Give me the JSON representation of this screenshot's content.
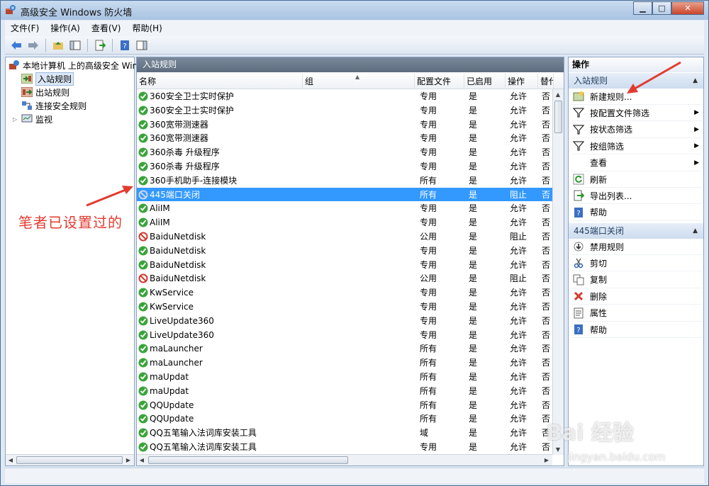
{
  "window": {
    "title": "高级安全 Windows 防火墙"
  },
  "menu": [
    "文件(F)",
    "操作(A)",
    "查看(V)",
    "帮助(H)"
  ],
  "tree": {
    "root": "本地计算机 上的高级安全 Wind",
    "items": [
      "入站规则",
      "出站规则",
      "连接安全规则",
      "监视"
    ]
  },
  "list": {
    "title": "入站规则",
    "columns": [
      "名称",
      "组",
      "配置文件",
      "已启用",
      "操作",
      "替代"
    ],
    "rows": [
      {
        "name": "360安全卫士实时保护",
        "profile": "专用",
        "enabled": "是",
        "action": "允许",
        "override": "否",
        "icon": "allow"
      },
      {
        "name": "360安全卫士实时保护",
        "profile": "专用",
        "enabled": "是",
        "action": "允许",
        "override": "否",
        "icon": "allow"
      },
      {
        "name": "360宽带测速器",
        "profile": "专用",
        "enabled": "是",
        "action": "允许",
        "override": "否",
        "icon": "allow"
      },
      {
        "name": "360宽带测速器",
        "profile": "专用",
        "enabled": "是",
        "action": "允许",
        "override": "否",
        "icon": "allow"
      },
      {
        "name": "360杀毒 升级程序",
        "profile": "专用",
        "enabled": "是",
        "action": "允许",
        "override": "否",
        "icon": "allow"
      },
      {
        "name": "360杀毒 升级程序",
        "profile": "专用",
        "enabled": "是",
        "action": "允许",
        "override": "否",
        "icon": "allow"
      },
      {
        "name": "360手机助手-连接模块",
        "profile": "所有",
        "enabled": "是",
        "action": "允许",
        "override": "否",
        "icon": "allow"
      },
      {
        "name": "445端口关闭",
        "profile": "所有",
        "enabled": "是",
        "action": "阻止",
        "override": "否",
        "icon": "block",
        "selected": true
      },
      {
        "name": "AliIM",
        "profile": "专用",
        "enabled": "是",
        "action": "允许",
        "override": "否",
        "icon": "allow"
      },
      {
        "name": "AliIM",
        "profile": "专用",
        "enabled": "是",
        "action": "允许",
        "override": "否",
        "icon": "allow"
      },
      {
        "name": "BaiduNetdisk",
        "profile": "公用",
        "enabled": "是",
        "action": "阻止",
        "override": "否",
        "icon": "block"
      },
      {
        "name": "BaiduNetdisk",
        "profile": "专用",
        "enabled": "是",
        "action": "允许",
        "override": "否",
        "icon": "allow"
      },
      {
        "name": "BaiduNetdisk",
        "profile": "专用",
        "enabled": "是",
        "action": "允许",
        "override": "否",
        "icon": "allow"
      },
      {
        "name": "BaiduNetdisk",
        "profile": "公用",
        "enabled": "是",
        "action": "阻止",
        "override": "否",
        "icon": "block"
      },
      {
        "name": "KwService",
        "profile": "专用",
        "enabled": "是",
        "action": "允许",
        "override": "否",
        "icon": "allow"
      },
      {
        "name": "KwService",
        "profile": "专用",
        "enabled": "是",
        "action": "允许",
        "override": "否",
        "icon": "allow"
      },
      {
        "name": "LiveUpdate360",
        "profile": "专用",
        "enabled": "是",
        "action": "允许",
        "override": "否",
        "icon": "allow"
      },
      {
        "name": "LiveUpdate360",
        "profile": "专用",
        "enabled": "是",
        "action": "允许",
        "override": "否",
        "icon": "allow"
      },
      {
        "name": "maLauncher",
        "profile": "所有",
        "enabled": "是",
        "action": "允许",
        "override": "否",
        "icon": "allow"
      },
      {
        "name": "maLauncher",
        "profile": "所有",
        "enabled": "是",
        "action": "允许",
        "override": "否",
        "icon": "allow"
      },
      {
        "name": "maUpdat",
        "profile": "所有",
        "enabled": "是",
        "action": "允许",
        "override": "否",
        "icon": "allow"
      },
      {
        "name": "maUpdat",
        "profile": "所有",
        "enabled": "是",
        "action": "允许",
        "override": "否",
        "icon": "allow"
      },
      {
        "name": "QQUpdate",
        "profile": "所有",
        "enabled": "是",
        "action": "允许",
        "override": "否",
        "icon": "allow"
      },
      {
        "name": "QQUpdate",
        "profile": "所有",
        "enabled": "是",
        "action": "允许",
        "override": "否",
        "icon": "allow"
      },
      {
        "name": "QQ五笔输入法词库安装工具",
        "profile": "域",
        "enabled": "是",
        "action": "允许",
        "override": "否",
        "icon": "allow"
      },
      {
        "name": "QQ五笔输入法词库安装工具",
        "profile": "专用",
        "enabled": "是",
        "action": "允许",
        "override": "否",
        "icon": "allow"
      }
    ]
  },
  "actions": {
    "title": "操作",
    "section1": "入站规则",
    "section1_items": [
      {
        "label": "新建规则...",
        "icon": "new-rule-icon",
        "submenu": false
      },
      {
        "label": "按配置文件筛选",
        "icon": "filter-icon",
        "submenu": true
      },
      {
        "label": "按状态筛选",
        "icon": "filter-icon",
        "submenu": true
      },
      {
        "label": "按组筛选",
        "icon": "filter-icon",
        "submenu": true
      },
      {
        "label": "查看",
        "icon": "",
        "submenu": true
      },
      {
        "label": "刷新",
        "icon": "refresh-icon",
        "submenu": false
      },
      {
        "label": "导出列表...",
        "icon": "export-icon",
        "submenu": false
      },
      {
        "label": "帮助",
        "icon": "help-icon",
        "submenu": false
      }
    ],
    "section2": "445端口关闭",
    "section2_items": [
      {
        "label": "禁用规则",
        "icon": "disable-icon"
      },
      {
        "label": "剪切",
        "icon": "cut-icon"
      },
      {
        "label": "复制",
        "icon": "copy-icon"
      },
      {
        "label": "删除",
        "icon": "delete-icon"
      },
      {
        "label": "属性",
        "icon": "properties-icon"
      },
      {
        "label": "帮助",
        "icon": "help-icon"
      }
    ]
  },
  "annotation": "笔者已设置过的",
  "watermark": {
    "main": "Bai 经验",
    "sub": "jingyan.baidu.com"
  },
  "colors": {
    "selection": "#3399ff",
    "annotation": "#e23b30",
    "allow": "#3aa43a",
    "block": "#d23a2e"
  }
}
